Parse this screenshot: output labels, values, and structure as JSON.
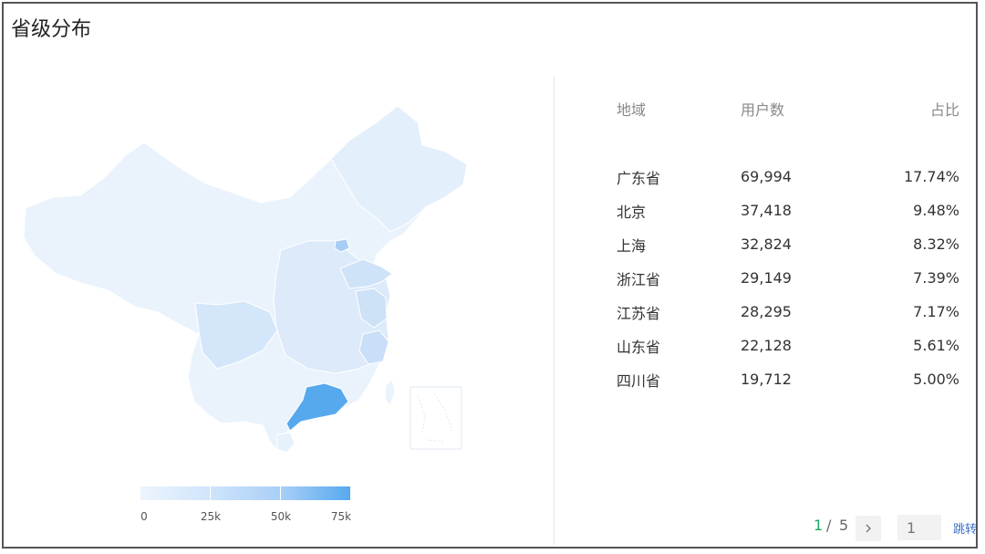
{
  "title": "省级分布",
  "legend": {
    "labels": [
      "0",
      "25k",
      "50k",
      "75k"
    ]
  },
  "table": {
    "headers": {
      "region": "地域",
      "users": "用户数",
      "ratio": "占比"
    },
    "rows": [
      {
        "region": "广东省",
        "users": "69,994",
        "ratio": "17.74%"
      },
      {
        "region": "北京",
        "users": "37,418",
        "ratio": "9.48%"
      },
      {
        "region": "上海",
        "users": "32,824",
        "ratio": "8.32%"
      },
      {
        "region": "浙江省",
        "users": "29,149",
        "ratio": "7.39%"
      },
      {
        "region": "江苏省",
        "users": "28,295",
        "ratio": "7.17%"
      },
      {
        "region": "山东省",
        "users": "22,128",
        "ratio": "5.61%"
      },
      {
        "region": "四川省",
        "users": "19,712",
        "ratio": "5.00%"
      }
    ]
  },
  "pagination": {
    "current": "1",
    "separator": "/",
    "total": "5",
    "next_icon": "chevron-right-icon",
    "jump_input_placeholder": "1",
    "jump_label": "跳转"
  },
  "colors": {
    "scale_min": "#edf5fd",
    "scale_max": "#57a9ee",
    "highlight": "#57a9ee",
    "pager_current": "#1aab68"
  }
}
